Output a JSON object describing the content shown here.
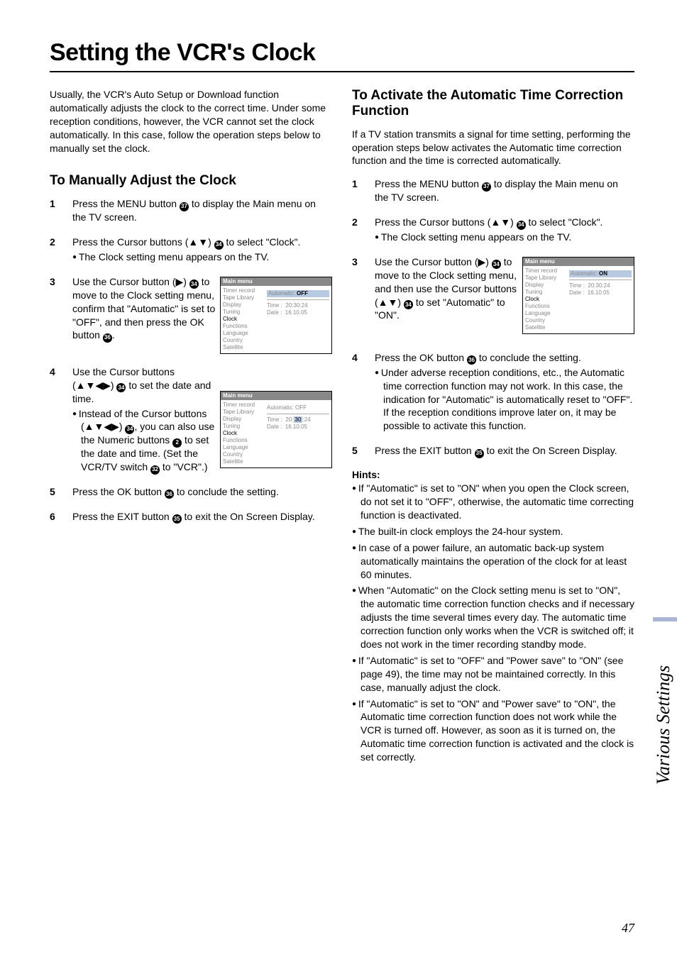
{
  "title": "Setting the VCR's Clock",
  "intro": "Usually, the VCR's Auto Setup or Download function automatically adjusts the clock to the correct time. Under some reception conditions, however, the VCR cannot set the clock automatically. In this case, follow the operation steps below to manually set the clock.",
  "manual": {
    "heading": "To Manually Adjust the Clock",
    "steps": {
      "s1a": "Press the MENU button ",
      "s1b": " to display the Main menu on the TV screen.",
      "s2a": "Press the Cursor buttons (▲▼) ",
      "s2b": " to select \"Clock\".",
      "s2c": "The Clock setting menu appears on the TV.",
      "s3a": "Use the Cursor button (▶) ",
      "s3b": " to move to the Clock setting menu, confirm that \"Automatic\" is set to \"OFF\", and then press the OK button ",
      "s3c": ".",
      "s4a": "Use the Cursor buttons (▲▼◀▶) ",
      "s4b": " to set the date and time.",
      "s4c1": "Instead of the Cursor buttons (▲▼◀▶) ",
      "s4c2": ", you can also use the Numeric buttons ",
      "s4c3": " to set the date and time. (Set the VCR/TV switch ",
      "s4c4": " to \"VCR\".)",
      "s5a": "Press the OK button ",
      "s5b": " to conclude the setting.",
      "s6a": "Press the EXIT button ",
      "s6b": " to exit the On Screen Display."
    }
  },
  "auto": {
    "heading": "To Activate the Automatic Time Correction Function",
    "intro": "If a TV station transmits a signal for time setting, performing the operation steps below activates the Automatic time correction function and the time is corrected automatically.",
    "steps": {
      "s1a": "Press the MENU button ",
      "s1b": " to display the Main menu on the TV screen.",
      "s2a": "Press the Cursor buttons (▲▼) ",
      "s2b": " to select \"Clock\".",
      "s2c": "The Clock setting menu appears on the TV.",
      "s3a": "Use the Cursor button (▶) ",
      "s3b": " to move to the Clock setting menu, and then use the Cursor buttons (▲▼) ",
      "s3c": " to set \"Automatic\" to \"ON\".",
      "s4a": "Press the OK button ",
      "s4b": " to conclude the setting.",
      "s4c": "Under adverse reception conditions, etc., the Automatic time correction function may not work. In this case, the indication for \"Automatic\" is automatically reset to \"OFF\". If the reception conditions improve later on, it may be possible to activate this function.",
      "s5a": "Press the EXIT button ",
      "s5b": " to exit the On Screen Display."
    }
  },
  "hints_label": "Hints:",
  "hints": [
    "If \"Automatic\" is set to \"ON\" when you open the Clock screen, do not set it to \"OFF\", otherwise, the automatic time correcting function is deactivated.",
    "The built-in clock employs the 24-hour system.",
    "In case of a power failure, an automatic back-up system automatically maintains the operation of the clock for at least 60 minutes.",
    "When \"Automatic\" on the Clock setting menu is set to \"ON\", the automatic time correction function checks and if necessary adjusts the time several times every day. The automatic time correction function only works when the VCR is switched off; it does not work in the timer recording standby mode.",
    "If \"Automatic\" is set to \"OFF\" and \"Power save\" to \"ON\" (see page 49), the time may not be maintained correctly. In this case, manually adjust the clock.",
    "If \"Automatic\" is set to \"ON\" and \"Power save\" to \"ON\", the Automatic time correction function does not work while the VCR is turned off. However, as soon as it is turned on, the Automatic time correction function is activated and the clock is set correctly."
  ],
  "refs": {
    "r37": "37",
    "r34": "34",
    "r36": "36",
    "r2": "2",
    "r32": "32",
    "r35": "35"
  },
  "menu_fig": {
    "header": "Main menu",
    "left_items": [
      "Timer record",
      "Tape Library",
      "Display",
      "Tuning",
      "Clock",
      "Functions",
      "Language",
      "Country",
      "Satellite"
    ],
    "auto_off_label": "Automatic: ",
    "auto_off_value": "OFF",
    "auto_on_label": "Automatic: ",
    "auto_on_value": "ON",
    "time_label": "Time  :",
    "time_value": "20:30:24",
    "time_value_b": "20:30:24",
    "date_label": "Date  :",
    "date_value": "16.10.05"
  },
  "side_tab": "Various Settings",
  "page_number": "47"
}
